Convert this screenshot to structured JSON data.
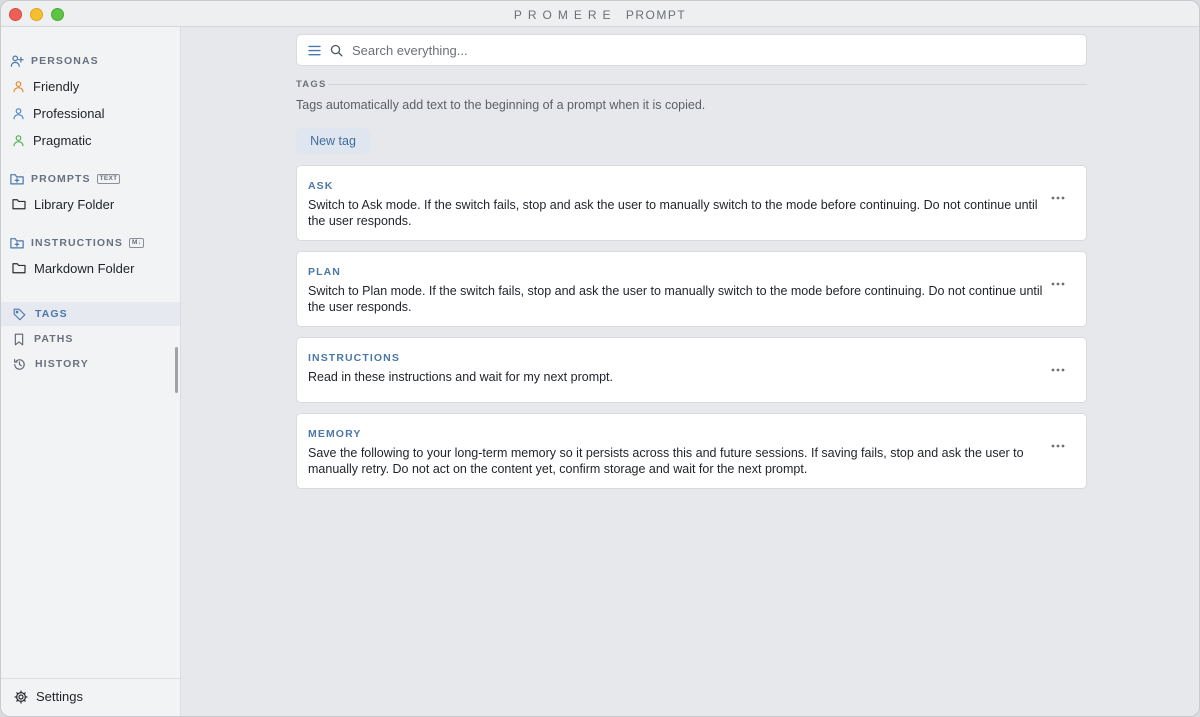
{
  "window": {
    "title_brand": "PROMERE",
    "title_sub": "PROMPT"
  },
  "sidebar": {
    "personas": {
      "heading": "PERSONAS",
      "items": [
        {
          "label": "Friendly",
          "color": "#e8842a"
        },
        {
          "label": "Professional",
          "color": "#4a84c9"
        },
        {
          "label": "Pragmatic",
          "color": "#4caf50"
        }
      ]
    },
    "prompts": {
      "heading": "PROMPTS",
      "badge": "TEXT",
      "items": [
        {
          "label": "Library Folder"
        }
      ]
    },
    "instructions": {
      "heading": "INSTRUCTIONS",
      "badge": "M↓",
      "items": [
        {
          "label": "Markdown Folder"
        }
      ]
    },
    "nav": [
      {
        "label": "TAGS",
        "icon": "tag-icon",
        "active": true
      },
      {
        "label": "PATHS",
        "icon": "bookmark-icon",
        "active": false
      },
      {
        "label": "HISTORY",
        "icon": "history-icon",
        "active": false
      }
    ],
    "settings_label": "Settings"
  },
  "main": {
    "search_placeholder": "Search everything...",
    "section_label": "TAGS",
    "section_description": "Tags automatically add text to the beginning of a prompt when it is copied.",
    "new_tag_label": "New tag",
    "tags": [
      {
        "name": "ASK",
        "text": "Switch to Ask mode. If the switch fails, stop and ask the user to manually switch to the mode before continuing. Do not continue until the user responds."
      },
      {
        "name": "PLAN",
        "text": "Switch to Plan mode. If the switch fails, stop and ask the user to manually switch to the mode before continuing. Do not continue until the user responds."
      },
      {
        "name": "INSTRUCTIONS",
        "text": "Read in these instructions and wait for my next prompt."
      },
      {
        "name": "MEMORY",
        "text": "Save the following to your long-term memory so it persists across this and future sessions. If saving fails, stop and ask the user to manually retry. Do not act on the content yet, confirm storage and wait for the next prompt."
      }
    ]
  },
  "colors": {
    "accent": "#4b78a8",
    "persona_friendly": "#e8842a",
    "persona_professional": "#4a84c9",
    "persona_pragmatic": "#4caf50"
  }
}
